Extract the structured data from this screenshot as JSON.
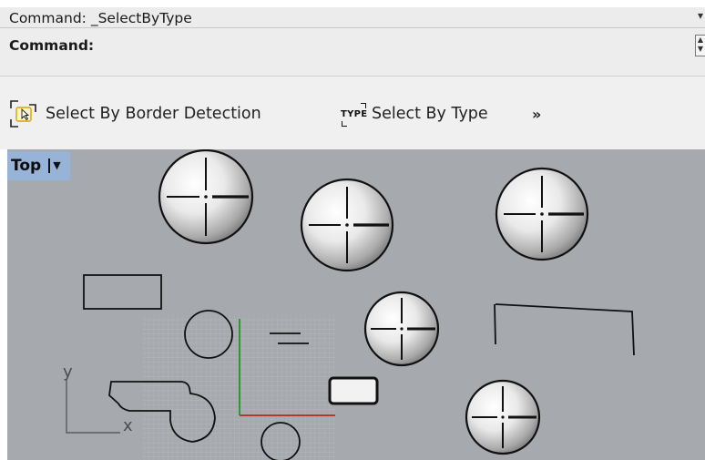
{
  "command": {
    "history": "Command: _SelectByType",
    "history_dropdown_icon": "chevron-down-icon",
    "prompt": "Command:",
    "spinner_icon": "spinner-icon"
  },
  "toolbar": {
    "border_detection_label": "Select By Border Detection",
    "border_detection_icon": "select-border-icon",
    "type_label": "Select By Type",
    "type_icon_text": "TYPE",
    "more_label": "»"
  },
  "viewport": {
    "title": "Top",
    "menu_icon": "viewport-menu-icon",
    "axis_x": "x",
    "axis_y": "y",
    "background": "#a6a9ad",
    "tab_color": "#97b3d8"
  }
}
